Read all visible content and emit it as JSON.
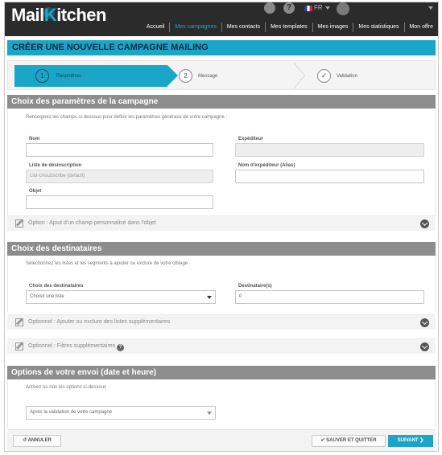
{
  "app": {
    "logo_prefix": "Mail",
    "logo_k": "K",
    "logo_suffix": "itchen",
    "brand_color": "#1aa6c9",
    "language": "FR"
  },
  "icons": {
    "chat": "chat-bubbles-icon",
    "help": "help-icon",
    "flag": "french-flag-icon",
    "avatar": "user-avatar-icon",
    "help_glyph": "?"
  },
  "nav": {
    "items": [
      {
        "label": "Accueil",
        "active": false
      },
      {
        "label": "Mes campagnes",
        "active": true
      },
      {
        "label": "Mes contacts",
        "active": false
      },
      {
        "label": "Mes templates",
        "active": false
      },
      {
        "label": "Mes images",
        "active": false
      },
      {
        "label": "Mes statistiques",
        "active": false
      },
      {
        "label": "Mon offre",
        "active": false
      }
    ]
  },
  "page": {
    "title": "CRÉER UNE NOUVELLE CAMPAGNE MAILING"
  },
  "stepper": {
    "steps": [
      {
        "number": "1",
        "label": "Paramètres",
        "active": true
      },
      {
        "number": "2",
        "label": "Message",
        "active": false
      },
      {
        "number": "✓",
        "label": "Validation",
        "active": false
      }
    ]
  },
  "section_params": {
    "heading": "Choix des paramètres de la campagne",
    "intro": "Renseignez les champs ci-dessous pour définir les paramètres généraux de votre campagne :",
    "nom_label": "Nom",
    "nom_value": "",
    "expediteur_label": "Expéditeur",
    "expediteur_value": "",
    "desinscription_label": "Liste de désinscription",
    "desinscription_value": "List-Unsubscribe (default)",
    "alias_label": "Nom d'expéditeur (Alias)",
    "alias_value": "",
    "objet_label": "Objet",
    "objet_value": "",
    "option_label": "Option : Ajout d'un champ personnalisé dans l'objet"
  },
  "section_dest": {
    "heading": "Choix des destinataires",
    "intro": "Sélectionnez les listes et les segments à ajouter ou exclure de votre ciblage",
    "choix_label": "Choix des destinataires",
    "choix_value": "Choisir une liste",
    "count_label": "Destinataire(s)",
    "count_value": "0",
    "option1_label": "Optionnel : Ajouter ou exclure des listes supplémentaires",
    "option2_label": "Optionnel : Filtres supplémentaires"
  },
  "section_envoi": {
    "heading": "Options de votre envoi (date et heure)",
    "intro": "Activez ou non les options ci-dessous",
    "select_value": "Après la validation de votre campagne"
  },
  "footer": {
    "cancel_label": "↺ ANNULER",
    "save_label": "✔ SAUVER ET QUITTER",
    "next_label": "SUIVANT ❯"
  }
}
